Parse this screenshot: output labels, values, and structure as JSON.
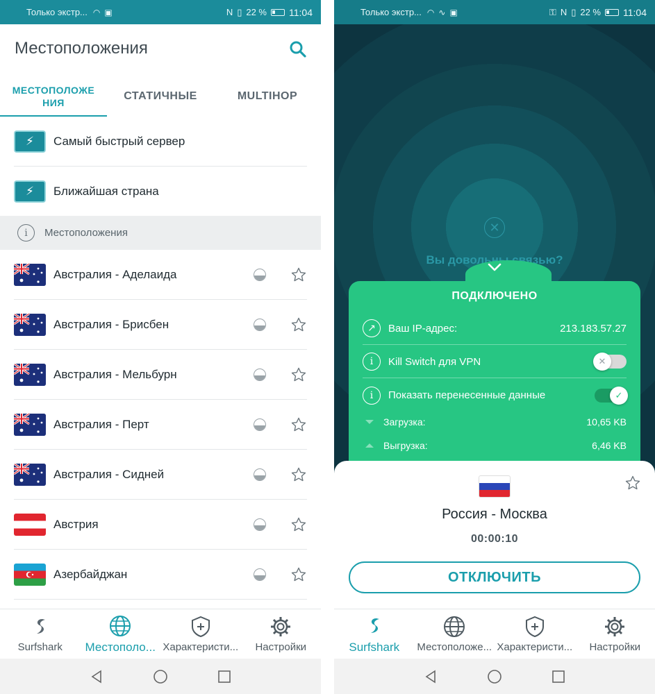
{
  "left_screen": {
    "statusbar": {
      "carrier": "Только экстр...",
      "battery": "22 %",
      "time": "11:04"
    },
    "title": "Местоположения",
    "tabs": [
      {
        "label": "МЕСТОПОЛОЖЕ\nНИЯ",
        "active": true
      },
      {
        "label": "СТАТИЧНЫЕ",
        "active": false
      },
      {
        "label": "MULTIHOP",
        "active": false
      }
    ],
    "quick_items": [
      {
        "label": "Самый быстрый сервер",
        "icon": "bolt-icon"
      },
      {
        "label": "Ближайшая страна",
        "icon": "bolt-icon"
      }
    ],
    "section_label": "Местоположения",
    "locations": [
      {
        "label": "Австралия - Аделаида",
        "flag": "australia"
      },
      {
        "label": "Австралия - Брисбен",
        "flag": "australia"
      },
      {
        "label": "Австралия - Мельбурн",
        "flag": "australia"
      },
      {
        "label": "Австралия - Перт",
        "flag": "australia"
      },
      {
        "label": "Австралия - Сидней",
        "flag": "australia"
      },
      {
        "label": "Австрия",
        "flag": "austria"
      },
      {
        "label": "Азербайджан",
        "flag": "azerbaijan"
      }
    ],
    "bottom_nav": [
      {
        "label": "Surfshark",
        "icon": "surfshark-logo-icon",
        "active": false
      },
      {
        "label": "Местополо...",
        "icon": "globe-icon",
        "active": true
      },
      {
        "label": "Характеристи...",
        "icon": "shield-plus-icon",
        "active": false
      },
      {
        "label": "Настройки",
        "icon": "gear-icon",
        "active": false
      }
    ]
  },
  "right_screen": {
    "statusbar": {
      "carrier": "Только экстр...",
      "battery": "22 %",
      "time": "11:04"
    },
    "feedback_question": "Вы довольны связью?",
    "status_title": "ПОДКЛЮЧЕНО",
    "ip_label": "Ваш IP-адрес:",
    "ip_value": "213.183.57.27",
    "kill_switch_label": "Kill Switch для VPN",
    "kill_switch_on": false,
    "show_data_label": "Показать перенесенные данные",
    "show_data_on": true,
    "download_label": "Загрузка:",
    "download_value": "10,65 KB",
    "upload_label": "Выгрузка:",
    "upload_value": "6,46 KB",
    "server_name": "Россия - Москва",
    "timer": "00:00:10",
    "disconnect_label": "ОТКЛЮЧИТЬ",
    "bottom_nav": [
      {
        "label": "Surfshark",
        "icon": "surfshark-logo-icon",
        "active": true
      },
      {
        "label": "Местоположе...",
        "icon": "globe-icon",
        "active": false
      },
      {
        "label": "Характеристи...",
        "icon": "shield-plus-icon",
        "active": false
      },
      {
        "label": "Настройки",
        "icon": "gear-icon",
        "active": false
      }
    ]
  },
  "colors": {
    "accent": "#1a9eac",
    "connected_green": "#27c683",
    "statusbar": "#1b8c9b"
  }
}
